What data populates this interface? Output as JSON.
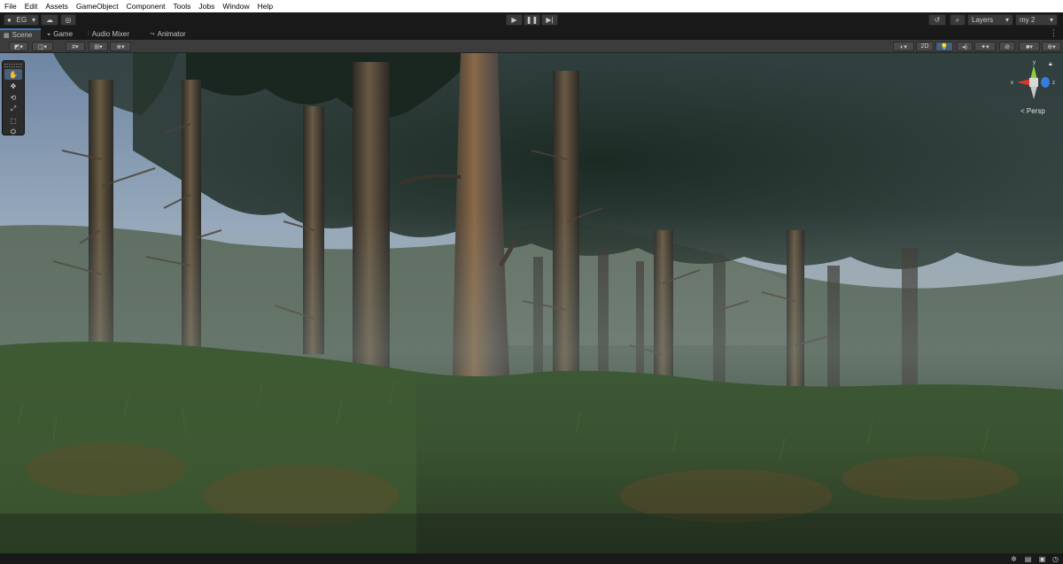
{
  "menu": [
    "File",
    "Edit",
    "Assets",
    "GameObject",
    "Component",
    "Tools",
    "Jobs",
    "Window",
    "Help"
  ],
  "toolbar": {
    "account_label": "EG",
    "layers_label": "Layers",
    "layout_label": "my 2"
  },
  "tabs": [
    {
      "label": "Scene",
      "icon": "scene-grid-icon",
      "active": true
    },
    {
      "label": "Game",
      "icon": "gamepad-icon",
      "active": false
    },
    {
      "label": "Audio Mixer",
      "icon": "audio-mixer-icon",
      "active": false
    },
    {
      "label": "Animator",
      "icon": "animator-icon",
      "active": false
    }
  ],
  "scene_toolbar": {
    "mode_2d_label": "2D"
  },
  "tool_palette": [
    "hand-tool",
    "move-tool",
    "rotate-tool",
    "scale-tool",
    "rect-tool",
    "transform-tool"
  ],
  "gizmo": {
    "x_label": "x",
    "y_label": "y",
    "z_label": "z",
    "projection_label": "< Persp",
    "colors": {
      "x": "#d8382a",
      "y": "#8bd237",
      "z": "#3a7be0"
    }
  },
  "status_icons": [
    "bug-icon",
    "cache-icon",
    "chip-icon",
    "clock-icon"
  ]
}
